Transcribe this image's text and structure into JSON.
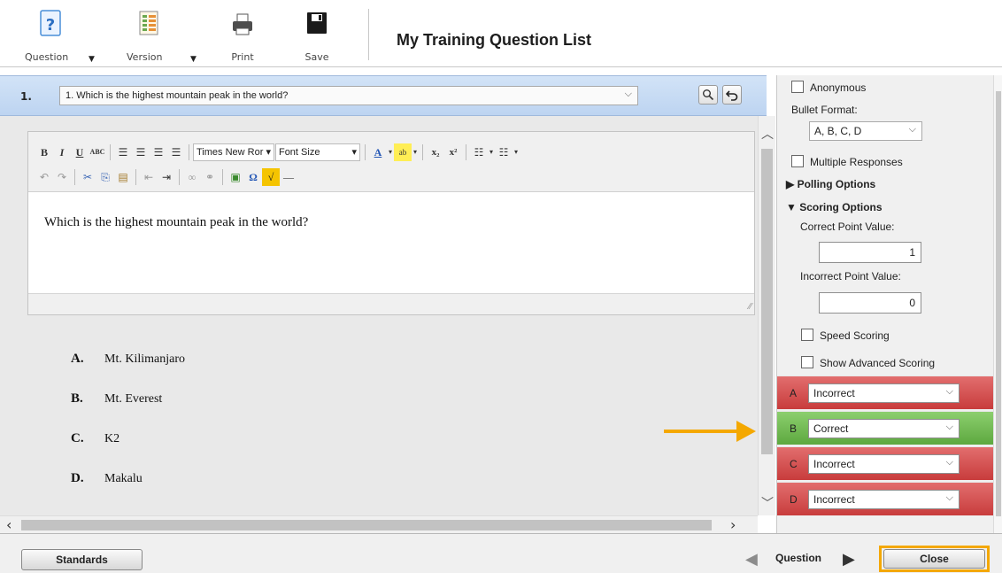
{
  "toolbar": {
    "question_label": "Question",
    "version_label": "Version",
    "print_label": "Print",
    "save_label": "Save",
    "title": "My Training Question List"
  },
  "question_header": {
    "number": "1.",
    "selected_question": "1. Which is the highest mountain peak in the world?"
  },
  "editor": {
    "font_name": "Times New Ror",
    "font_size": "Font Size",
    "body_text": "Which is the highest mountain peak in the world?"
  },
  "answers": [
    {
      "letter": "A.",
      "text": "Mt. Kilimanjaro"
    },
    {
      "letter": "B.",
      "text": "Mt. Everest"
    },
    {
      "letter": "C.",
      "text": "K2"
    },
    {
      "letter": "D.",
      "text": "Makalu"
    }
  ],
  "settings": {
    "anonymous_label": "Anonymous",
    "bullet_format_label": "Bullet Format:",
    "bullet_format_value": "A, B, C, D",
    "multiple_responses_label": "Multiple Responses",
    "polling_options_label": "Polling Options",
    "scoring_options_label": "Scoring Options",
    "correct_point_label": "Correct Point Value:",
    "correct_point_value": "1",
    "incorrect_point_label": "Incorrect Point Value:",
    "incorrect_point_value": "0",
    "speed_scoring_label": "Speed Scoring",
    "advanced_scoring_label": "Show Advanced Scoring"
  },
  "answer_status": [
    {
      "letter": "A",
      "status": "Incorrect"
    },
    {
      "letter": "B",
      "status": "Correct"
    },
    {
      "letter": "C",
      "status": "Incorrect"
    },
    {
      "letter": "D",
      "status": "Incorrect"
    }
  ],
  "bottom": {
    "standards_label": "Standards",
    "nav_label": "Question",
    "close_label": "Close"
  },
  "colors": {
    "correct": "#6cb84c",
    "incorrect": "#d24b4b",
    "highlight": "#f4a800",
    "header_blue": "#c8dcf5"
  }
}
